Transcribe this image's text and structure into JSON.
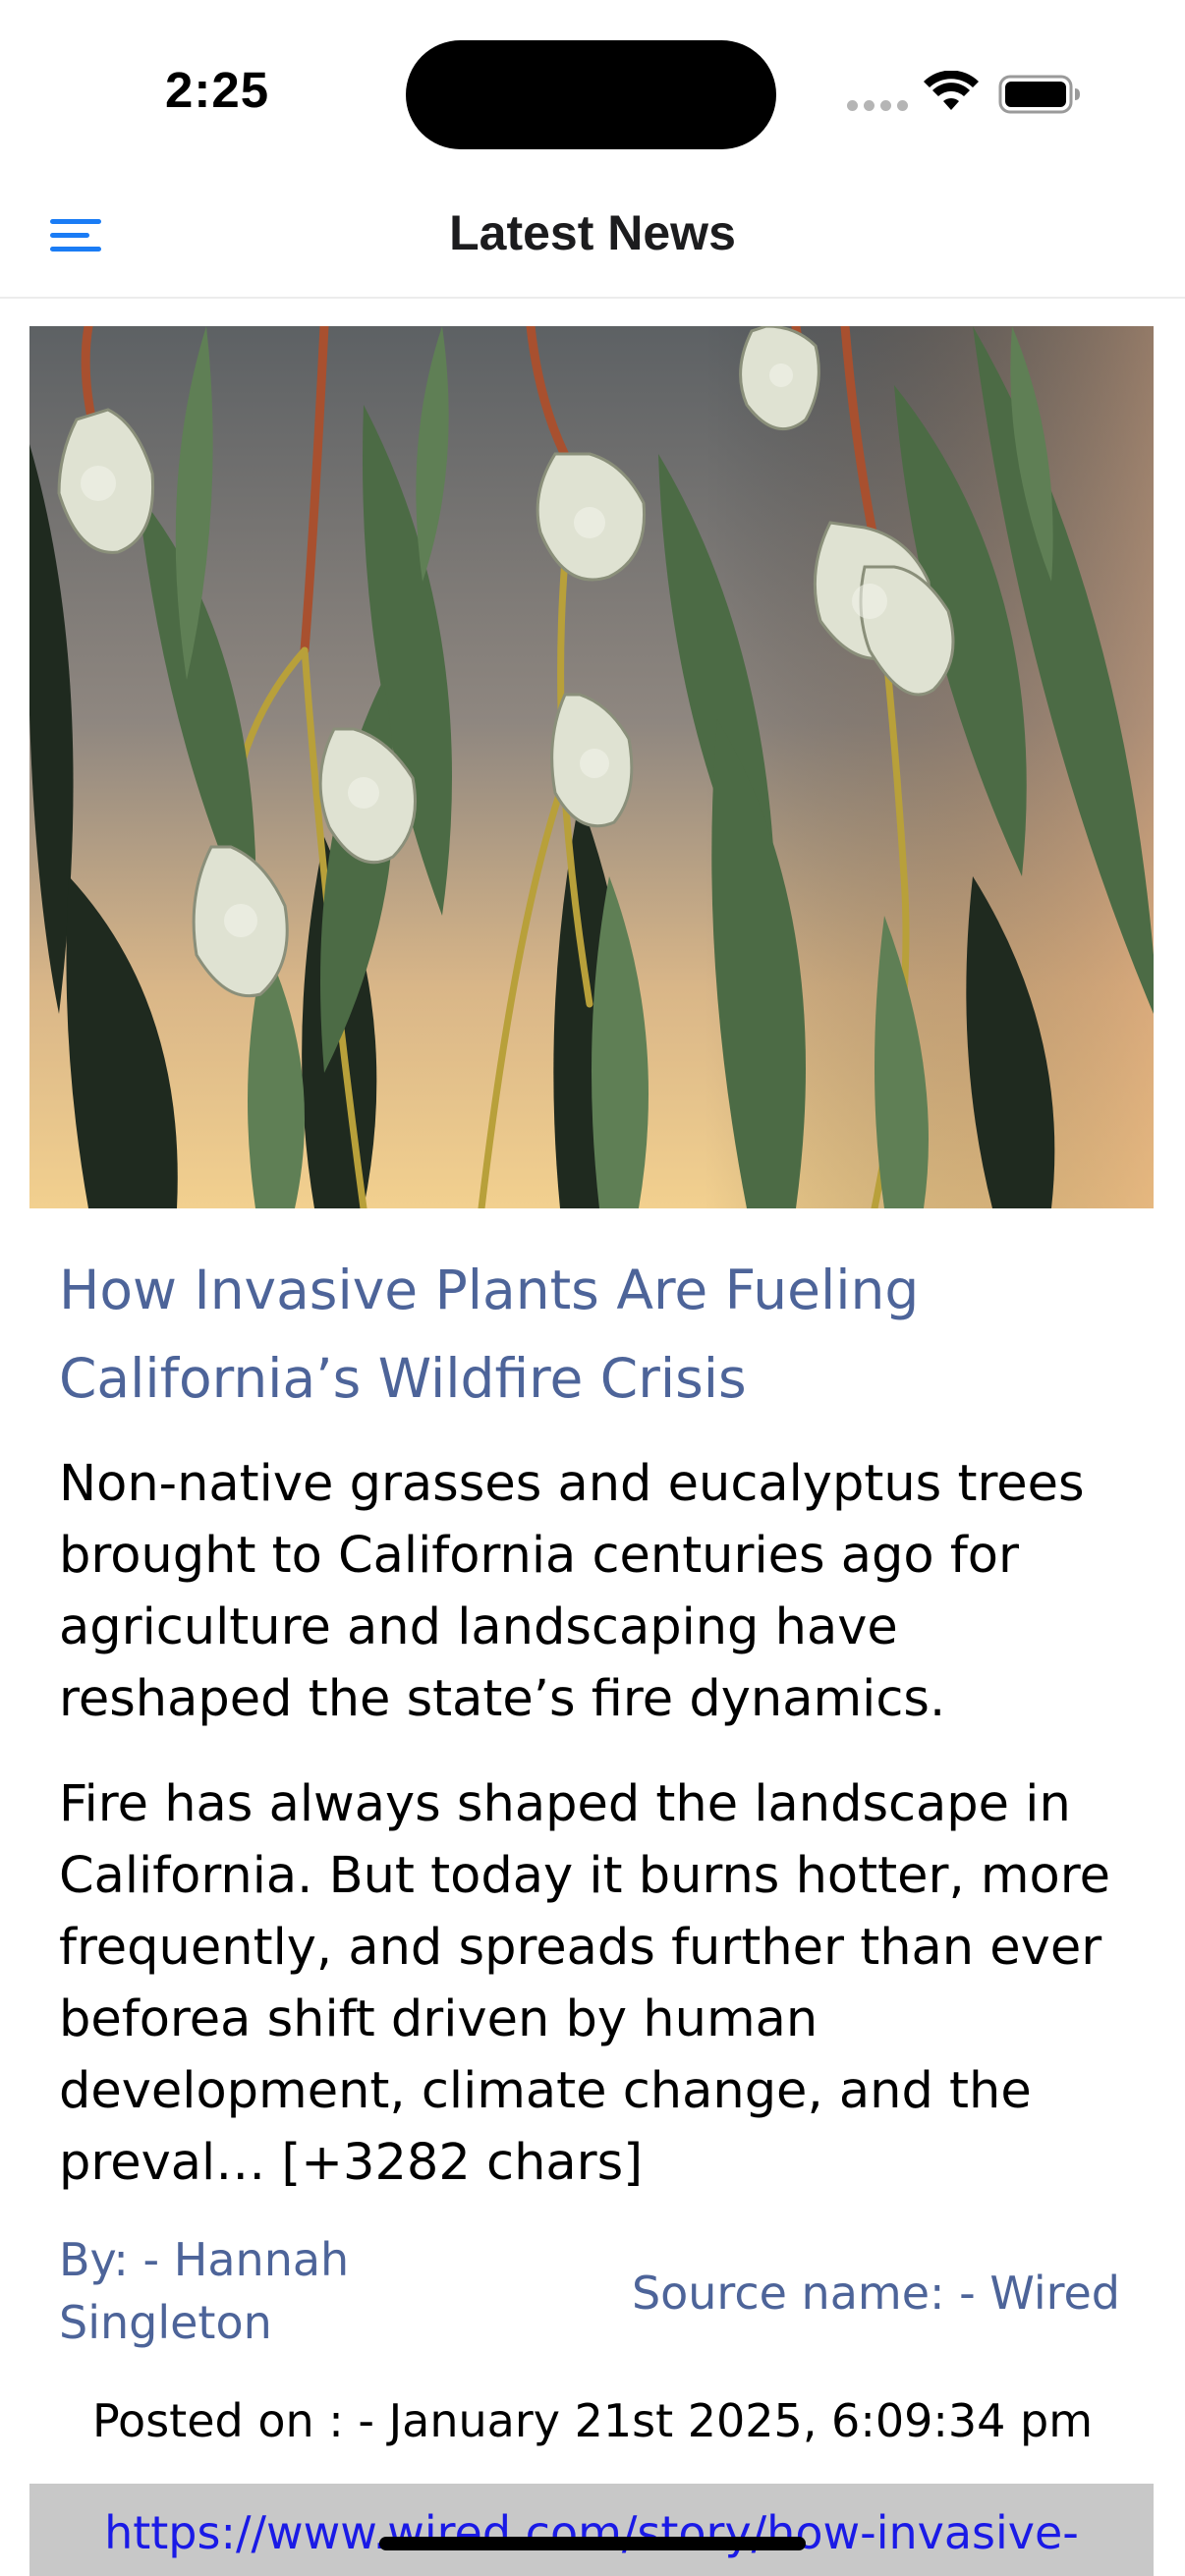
{
  "status_bar": {
    "time": "2:25",
    "icons": [
      "cellular-signal-icon",
      "wifi-icon",
      "battery-icon"
    ]
  },
  "nav": {
    "title": "Latest News",
    "menu_icon": "hamburger-menu-icon"
  },
  "colors": {
    "accent": "#1a7cf5",
    "title_blue": "#4d6499",
    "link_blue": "#1a1ae6",
    "link_bar_bg": "#c8c8c8"
  },
  "article": {
    "image_subject": "eucalyptus-leaves-and-flower-buds-photo",
    "title": "How Invasive Plants Are Fueling California’s Wildfire Crisis",
    "description": "Non-native grasses and eucalyptus trees brought to California centuries ago for agriculture and landscaping have reshaped the state’s fire dynamics.",
    "content": "Fire has always shaped the landscape in California. But today it burns hotter, more frequently, and spreads further than ever beforea shift driven by human development, climate change, and the preval… [+3282 chars]",
    "author": "By: - Hannah Singleton",
    "source": "Source name: - Wired",
    "posted_on": "Posted on : - January 21st 2025, 6:09:34 pm",
    "url": "https://www.wired.com/story/how-invasive-"
  }
}
